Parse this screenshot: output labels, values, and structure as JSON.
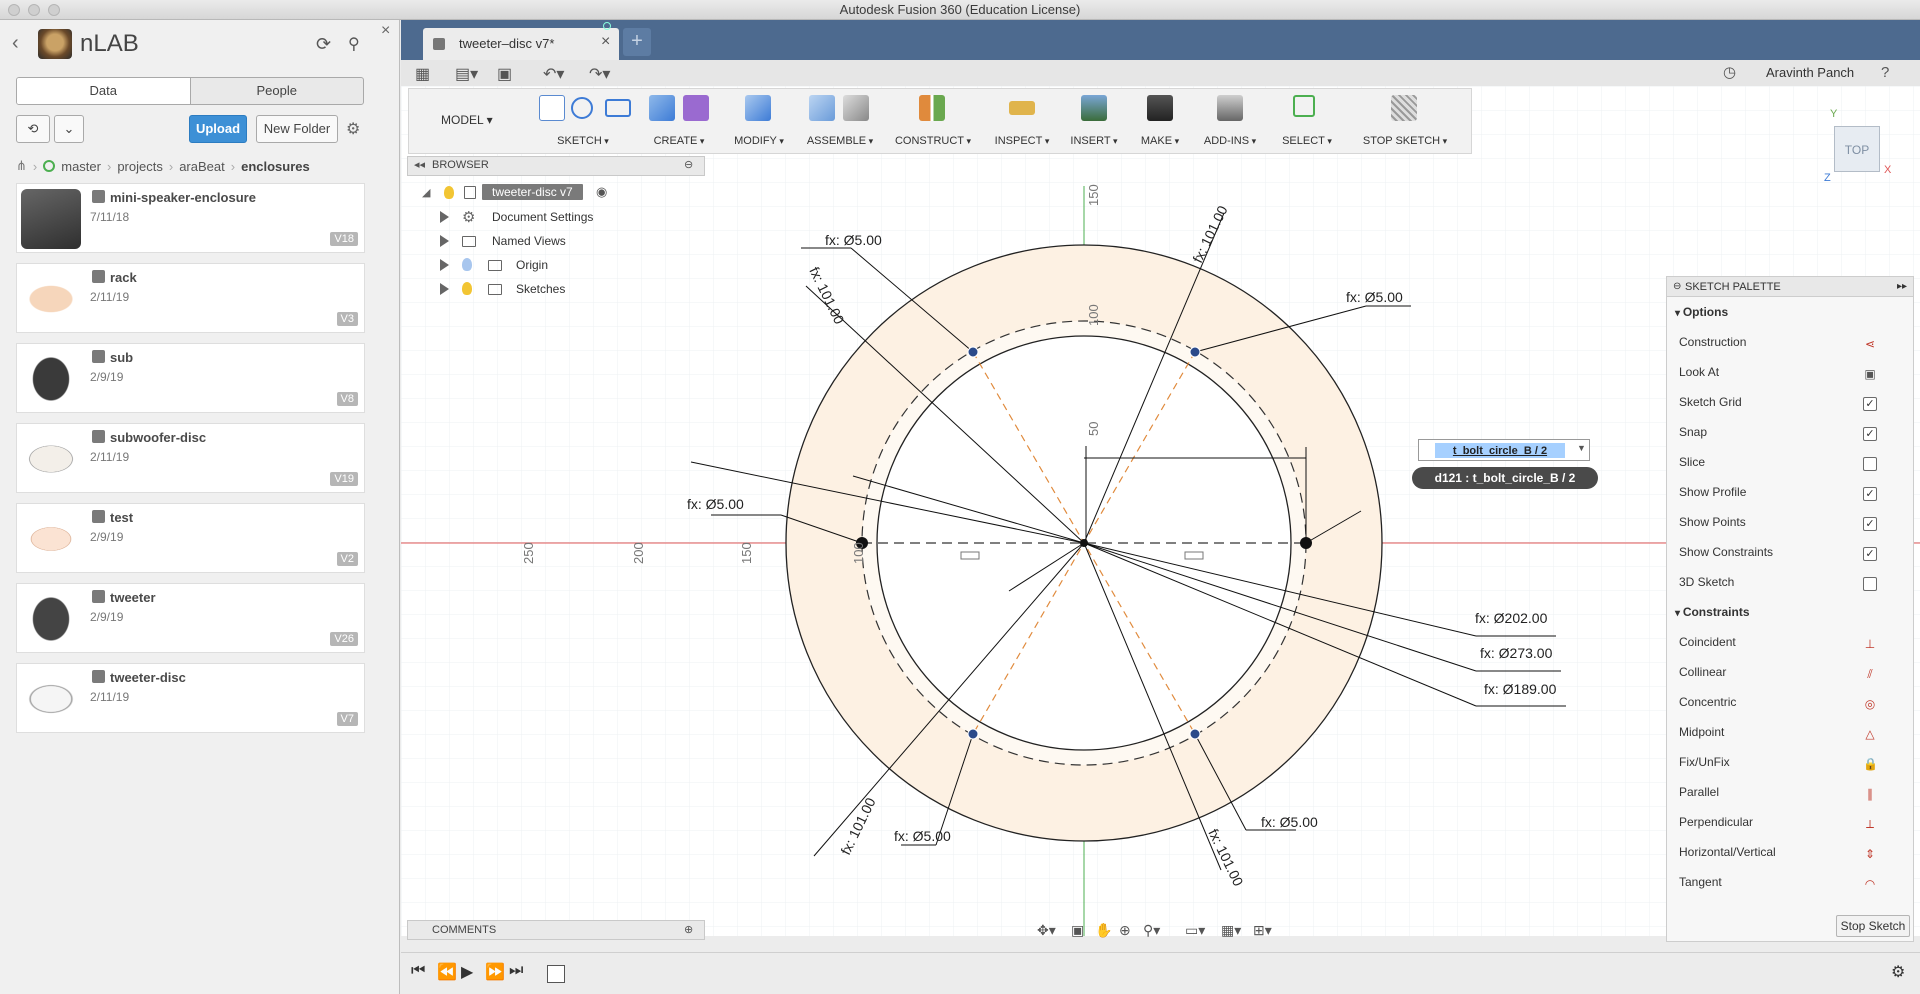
{
  "window": {
    "title": "Autodesk Fusion 360 (Education License)"
  },
  "data_panel": {
    "project_name": "nLAB",
    "tabs": [
      {
        "label": "Data"
      },
      {
        "label": "People"
      }
    ],
    "upload_label": "Upload",
    "new_folder_label": "New Folder",
    "breadcrumb": [
      "master",
      "projects",
      "araBeat",
      "enclosures"
    ],
    "files": [
      {
        "name": "mini-speaker-enclosure",
        "date": "7/11/18",
        "version": "V18"
      },
      {
        "name": "rack",
        "date": "2/11/19",
        "version": "V3"
      },
      {
        "name": "sub",
        "date": "2/9/19",
        "version": "V8"
      },
      {
        "name": "subwoofer-disc",
        "date": "2/11/19",
        "version": "V19"
      },
      {
        "name": "test",
        "date": "2/9/19",
        "version": "V2"
      },
      {
        "name": "tweeter",
        "date": "2/9/19",
        "version": "V26"
      },
      {
        "name": "tweeter-disc",
        "date": "2/11/19",
        "version": "V7"
      }
    ]
  },
  "document_tab": {
    "title": "tweeter–disc v7*"
  },
  "app_bar": {
    "user_name": "Aravinth Panch"
  },
  "ribbon": {
    "workspace": "MODEL",
    "groups": [
      {
        "label": "SKETCH"
      },
      {
        "label": "CREATE"
      },
      {
        "label": "MODIFY"
      },
      {
        "label": "ASSEMBLE"
      },
      {
        "label": "CONSTRUCT"
      },
      {
        "label": "INSPECT"
      },
      {
        "label": "INSERT"
      },
      {
        "label": "MAKE"
      },
      {
        "label": "ADD-INS"
      },
      {
        "label": "SELECT"
      },
      {
        "label": "STOP SKETCH"
      }
    ]
  },
  "browser": {
    "title": "BROWSER",
    "root": "tweeter-disc v7",
    "items": [
      {
        "label": "Document Settings"
      },
      {
        "label": "Named Views"
      },
      {
        "label": "Origin"
      },
      {
        "label": "Sketches"
      }
    ]
  },
  "comments": {
    "title": "COMMENTS"
  },
  "viewcube": {
    "face": "TOP",
    "axes": {
      "x": "X",
      "y": "Y",
      "z": "Z"
    }
  },
  "canvas": {
    "ruler_labels_horizontal": [
      "250",
      "200",
      "150",
      "100"
    ],
    "ruler_labels_vertical": [
      "150",
      "100",
      "50"
    ],
    "dimensions": {
      "hole_top_left": "fx: Ø5.00",
      "hole_top_right": "fx: Ø5.00",
      "hole_left": "fx: Ø5.00",
      "hole_bottom_left": "fx: Ø5.00",
      "hole_bottom_right": "fx: Ø5.00",
      "radius_top_right": "fx: 101.00",
      "radius_top_left": "fx: 101.00",
      "radius_bottom_left": "fx: 101.00",
      "radius_bottom_right": "fx: 101.00",
      "diameter_202": "fx: Ø202.00",
      "diameter_273": "fx: Ø273.00",
      "diameter_189": "fx: Ø189.00"
    },
    "dimension_input_value": "t_bolt_circle_B / 2",
    "dimension_tooltip": "d121 : t_bolt_circle_B / 2",
    "colors": {
      "disc_fill": "#fdf1e3",
      "x_axis": "#e05757",
      "y_axis": "#4caf50",
      "construction": "#e08a3c",
      "point": "#2b4a8a"
    }
  },
  "sketch_palette": {
    "title": "SKETCH PALETTE",
    "options_label": "Options",
    "options": [
      {
        "label": "Construction",
        "control": "glyph",
        "glyph": "⋖"
      },
      {
        "label": "Look At",
        "control": "glyph",
        "glyph": "▣"
      },
      {
        "label": "Sketch Grid",
        "control": "checkbox",
        "checked": true
      },
      {
        "label": "Snap",
        "control": "checkbox",
        "checked": true
      },
      {
        "label": "Slice",
        "control": "checkbox",
        "checked": false
      },
      {
        "label": "Show Profile",
        "control": "checkbox",
        "checked": true
      },
      {
        "label": "Show Points",
        "control": "checkbox",
        "checked": true
      },
      {
        "label": "Show Constraints",
        "control": "checkbox",
        "checked": true
      },
      {
        "label": "3D Sketch",
        "control": "checkbox",
        "checked": false
      }
    ],
    "constraints_label": "Constraints",
    "constraints": [
      {
        "label": "Coincident",
        "glyph": "⊥"
      },
      {
        "label": "Collinear",
        "glyph": "⫽"
      },
      {
        "label": "Concentric",
        "glyph": "◎"
      },
      {
        "label": "Midpoint",
        "glyph": "△"
      },
      {
        "label": "Fix/UnFix",
        "glyph": "🔒"
      },
      {
        "label": "Parallel",
        "glyph": "∥"
      },
      {
        "label": "Perpendicular",
        "glyph": "⟂"
      },
      {
        "label": "Horizontal/Vertical",
        "glyph": "⇕"
      },
      {
        "label": "Tangent",
        "glyph": "◠"
      }
    ],
    "stop_sketch_label": "Stop Sketch"
  }
}
